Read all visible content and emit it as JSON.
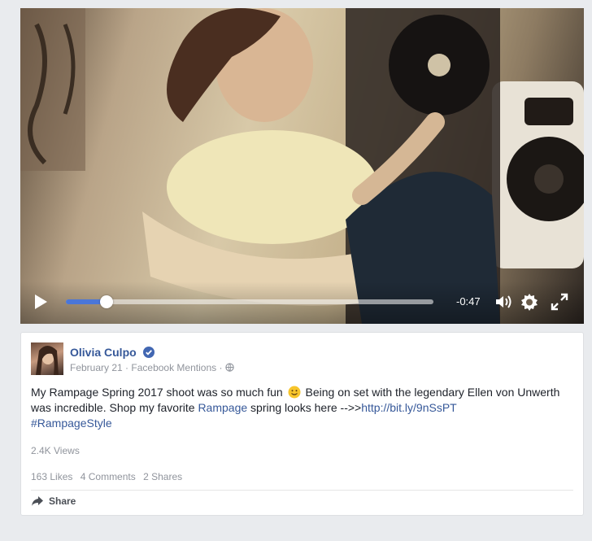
{
  "video": {
    "time_remaining": "-0:47",
    "progress": 0.11
  },
  "post": {
    "author": "Olivia Culpo",
    "date": "February 21",
    "source": "Facebook Mentions",
    "separator": "·",
    "text_part1": "My Rampage Spring 2017 shoot was so much fun",
    "text_part2": "Being on set with the legendary Ellen von Unwerth was incredible. Shop my favorite",
    "link_brand": "Rampage",
    "text_part3": "spring looks here -->>",
    "link_url": "http://bit.ly/9nSsPT",
    "hashtag": "#RampageStyle",
    "views": "2.4K Views",
    "likes": "163 Likes",
    "comments": "4 Comments",
    "shares": "2 Shares",
    "share_label": "Share"
  },
  "colors": {
    "link": "#365899",
    "progress": "#4a76d8",
    "page_bg": "#e9ebee"
  }
}
